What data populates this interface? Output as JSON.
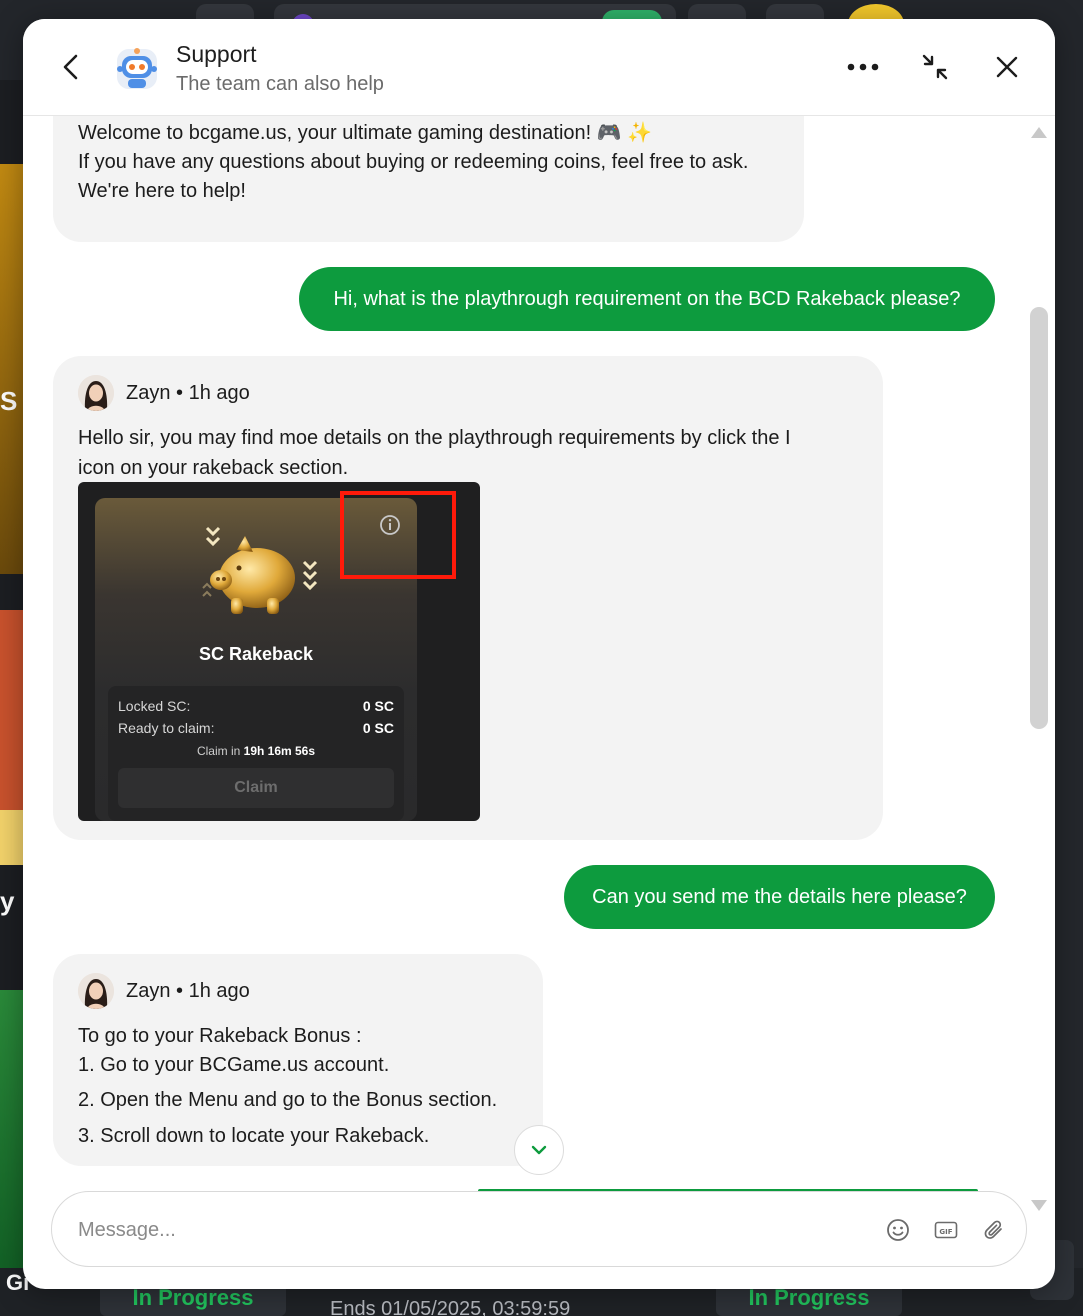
{
  "header": {
    "title": "Support",
    "subtitle": "The team can also help"
  },
  "messages": {
    "welcome": {
      "line1": "Welcome to bcgame.us, your ultimate gaming destination! 🎮 ✨",
      "line2": "If you have any questions about buying or redeeming coins, feel free to ask.",
      "line3": "We're here to help!"
    },
    "user_1": "Hi, what is the playthrough requirement on the BCD Rakeback please?",
    "agent_1": {
      "name_time": "Zayn • 1h ago",
      "line1": "Hello sir, you may find moe details on the playthrough requirements by click the I",
      "line2": "icon on your rakeback section.",
      "image": {
        "title": "SC Rakeback",
        "locked_label": "Locked SC:",
        "locked_value": "0 SC",
        "ready_label": "Ready to claim:",
        "ready_value": "0 SC",
        "claim_in_prefix": "Claim in",
        "claim_in_time": "19h 16m 56s",
        "claim_button": "Claim"
      }
    },
    "user_2": "Can you send me the details here please?",
    "agent_2": {
      "name_time": "Zayn • 1h ago",
      "intro": "To go to your Rakeback Bonus :",
      "steps": [
        "1. Go to your BCGame.us account.",
        "2. Open the Menu and go to the Bonus section.",
        "3. Scroll down to locate your Rakeback."
      ]
    }
  },
  "composer": {
    "placeholder": "Message..."
  },
  "background": {
    "left_letters": [
      "S",
      "y"
    ],
    "status_1": "In Progress",
    "status_2": "In Progress",
    "ends": "Ends 01/05/2025, 03:59:59",
    "gift": "Gi"
  },
  "colors": {
    "accent_green": "#0d9b3e",
    "highlight_red": "#ff1a0a"
  }
}
